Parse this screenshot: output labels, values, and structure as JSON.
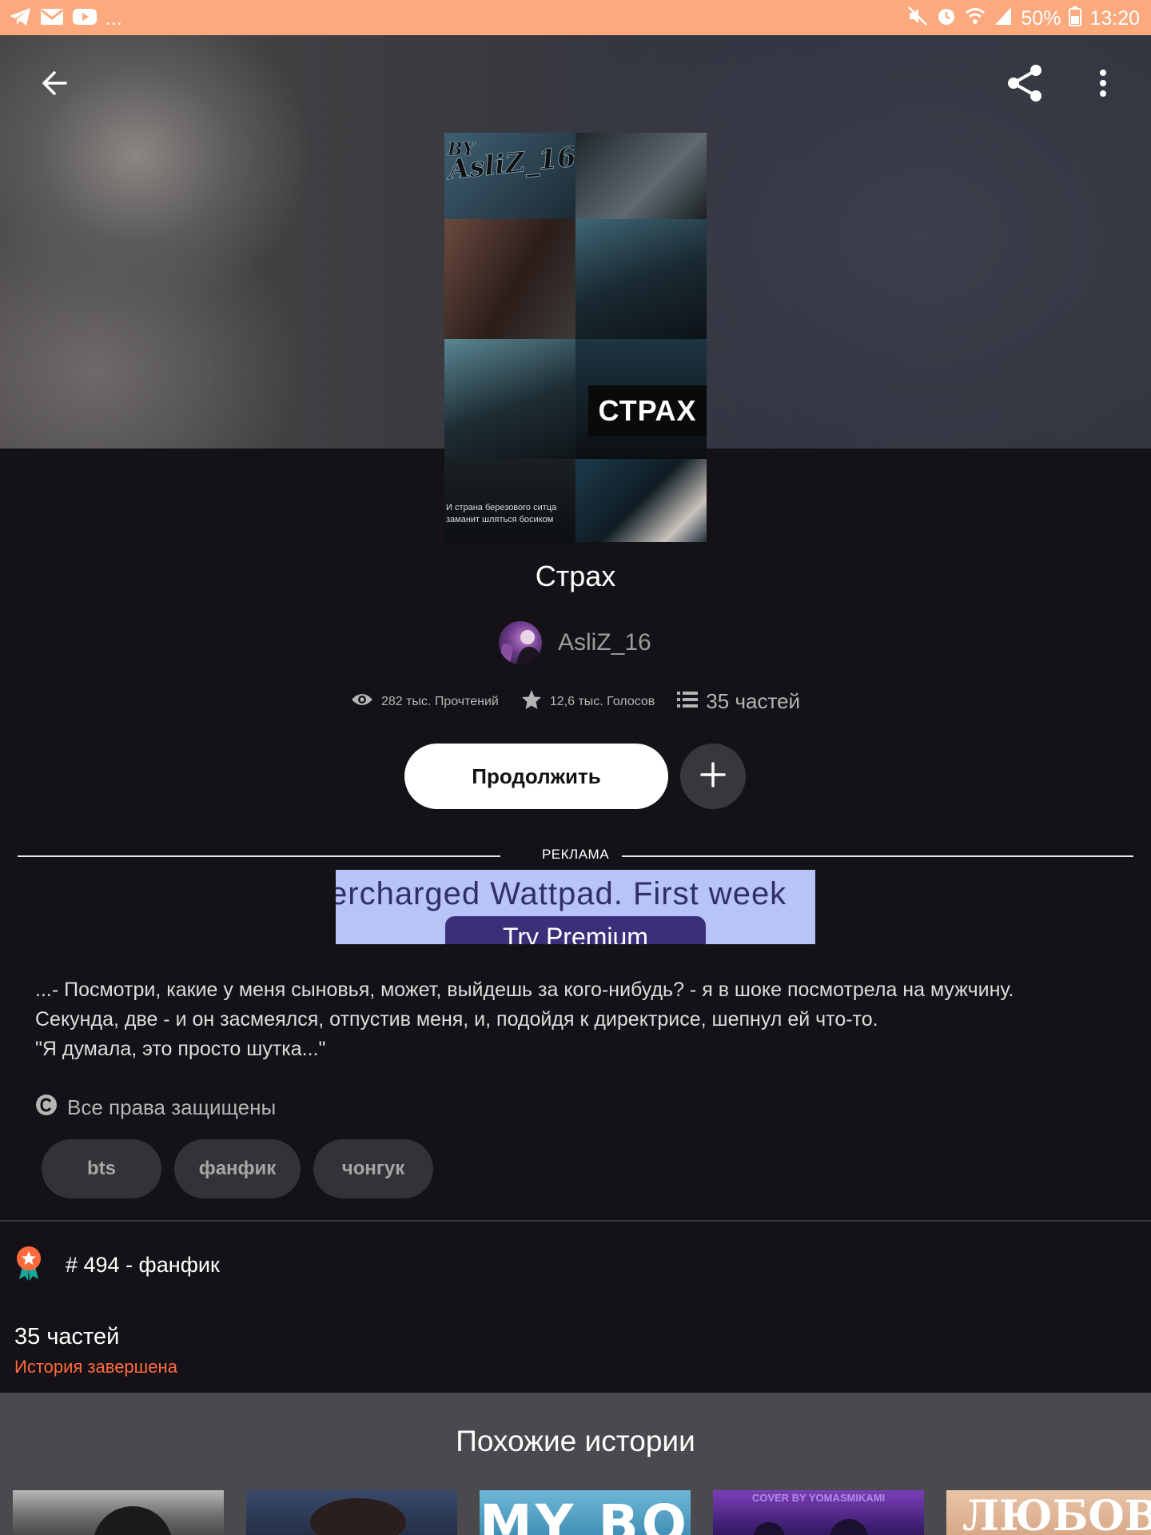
{
  "status_bar": {
    "left_icons": [
      "telegram-icon",
      "mail-icon",
      "youtube-icon"
    ],
    "overflow": "...",
    "battery": "50%",
    "time": "13:20"
  },
  "story": {
    "title": "Страх",
    "cover": {
      "watermark": "BY AsliZ_16",
      "title_text": "СТРАХ",
      "small_lines": [
        "И страна березового ситца",
        "заманит шляться босиком"
      ]
    },
    "author": "AsliZ_16",
    "stats": {
      "reads": "282 тыс. Прочтений",
      "votes": "12,6 тыс. Голосов",
      "parts": "35 частей"
    },
    "continue_label": "Продолжить",
    "description": [
      "...- Посмотри, какие у меня сыновья, может, выйдешь за кого-нибудь? - я в шоке посмотрела на мужчину.",
      "Секунда, две - и он засмеялся, отпустив меня, и, подойдя к директрисе, шепнул ей что-то.",
      "\"Я думала, это просто шутка...\""
    ],
    "rights": "Все права защищены",
    "tags": [
      "bts",
      "фанфик",
      "чонгук"
    ],
    "rank": "# 494 - фанфик",
    "parts_count": "35 частей",
    "parts_status": "История завершена"
  },
  "ad": {
    "label": "РЕКЛАМА",
    "text": "ercharged Wattpad. First week",
    "button": "Try Premium"
  },
  "similar": {
    "title": "Похожие истории",
    "thumb_texts": [
      "MY BOS is",
      "COVER BY YOMASMIKAMI",
      "ЛЮБОВЬ И"
    ]
  },
  "colors": {
    "accent": "#ff6a3d",
    "status_bar": "#fca97d",
    "background": "#141216"
  }
}
